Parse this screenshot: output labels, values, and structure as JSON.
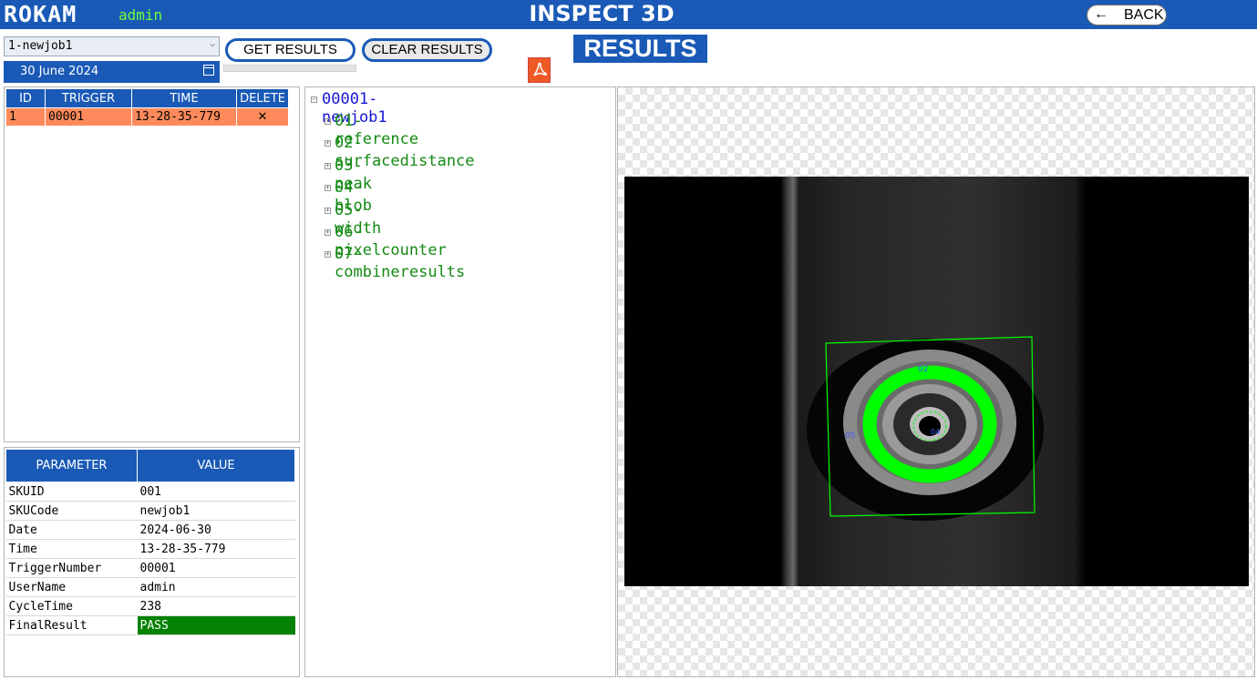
{
  "header": {
    "logo": "ROKAM",
    "user": "admin",
    "title": "INSPECT 3D",
    "back_arrow": "←",
    "back_label": "BACK"
  },
  "controls": {
    "job_select_value": "1-newjob1",
    "date_value": "30 June 2024",
    "get_results_label": "GET RESULTS",
    "clear_results_label": "CLEAR RESULTS",
    "results_heading": "RESULTS",
    "pdf_icon": "pdf-icon",
    "calendar_icon": "calendar-icon"
  },
  "trigger_table": {
    "headers": [
      "ID",
      "TRIGGER",
      "TIME",
      "DELETE"
    ],
    "rows": [
      {
        "id": "1",
        "trigger": "00001",
        "time": "13-28-35-779",
        "delete": "✕"
      }
    ]
  },
  "param_table": {
    "headers": [
      "PARAMETER",
      "VALUE"
    ],
    "rows": [
      {
        "parameter": "SKUID",
        "value": "001"
      },
      {
        "parameter": "SKUCode",
        "value": "newjob1"
      },
      {
        "parameter": "Date",
        "value": "2024-06-30"
      },
      {
        "parameter": "Time",
        "value": "13-28-35-779"
      },
      {
        "parameter": "TriggerNumber",
        "value": "00001"
      },
      {
        "parameter": "UserName",
        "value": "admin"
      },
      {
        "parameter": "CycleTime",
        "value": "238"
      },
      {
        "parameter": "FinalResult",
        "value": "PASS"
      }
    ]
  },
  "tree": {
    "root": "00001-newjob1",
    "root_toggle": "−",
    "item_toggle": "+",
    "items": [
      "01-reference",
      "02-surfacedistance",
      "03-peak",
      "04-blob",
      "05-width",
      "06-pixelcounter",
      "07-combineresults"
    ]
  },
  "image_view": {
    "roi_labels": [
      "02",
      "05",
      "04"
    ]
  },
  "colors": {
    "brand_blue": "#1a5ab6",
    "user_green": "#6bff3c",
    "selected_row": "#ff8a5b",
    "pass_green": "#038203",
    "tree_root": "#1515d6",
    "tree_item": "#148a14",
    "roi_green": "#00ff00"
  }
}
